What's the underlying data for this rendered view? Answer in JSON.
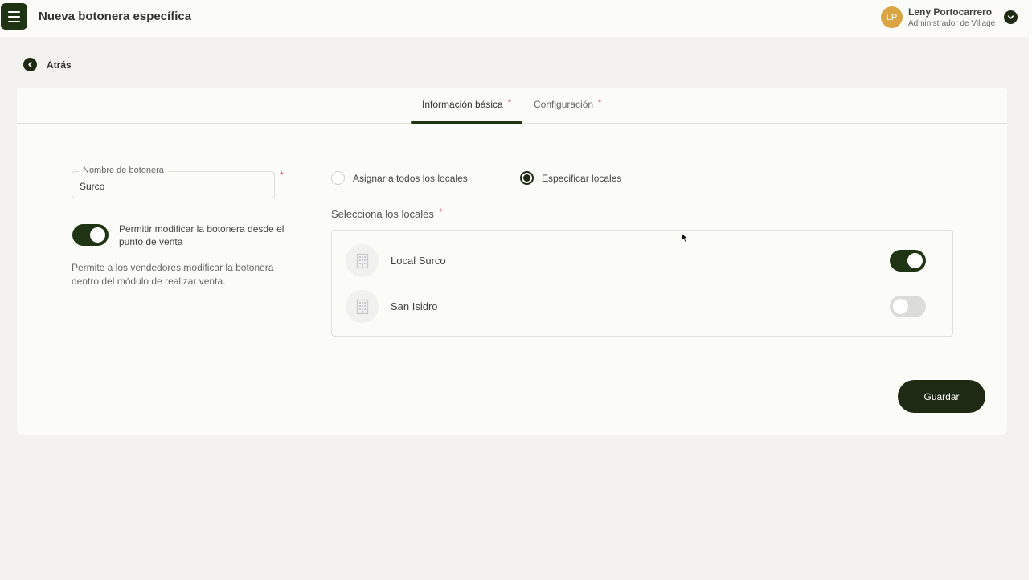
{
  "header": {
    "title": "Nueva botonera específica",
    "user": {
      "initials": "LP",
      "name": "Leny Portocarrero",
      "role": "Administrador de Village"
    }
  },
  "back_label": "Atrás",
  "tabs": [
    {
      "label": "Información básica",
      "required": "*",
      "active": true
    },
    {
      "label": "Configuración",
      "required": "*",
      "active": false
    }
  ],
  "form": {
    "name_field": {
      "label": "Nombre de botonera",
      "value": "Surco",
      "required": "*"
    },
    "allow_modify": {
      "enabled": true,
      "label": "Permitir modificar la botonera desde el punto de venta",
      "help": "Permite a los vendedores modificar la botonera dentro del módulo de realizar venta."
    },
    "assign_options": [
      {
        "label": "Asignar a todos los locales",
        "selected": false
      },
      {
        "label": "Especificar locales",
        "selected": true
      }
    ],
    "locales_title": "Selecciona los locales",
    "locales_required": "*",
    "locales": [
      {
        "name": "Local Surco",
        "enabled": true,
        "icon": "building-icon"
      },
      {
        "name": "San Isidro",
        "enabled": false,
        "icon": "building-icon"
      }
    ]
  },
  "save_label": "Guardar",
  "colors": {
    "primary": "#1f3413",
    "required": "#e0506a",
    "avatar": "#d9a441",
    "background": "#f3f2ef",
    "card": "#fbfbf8"
  }
}
